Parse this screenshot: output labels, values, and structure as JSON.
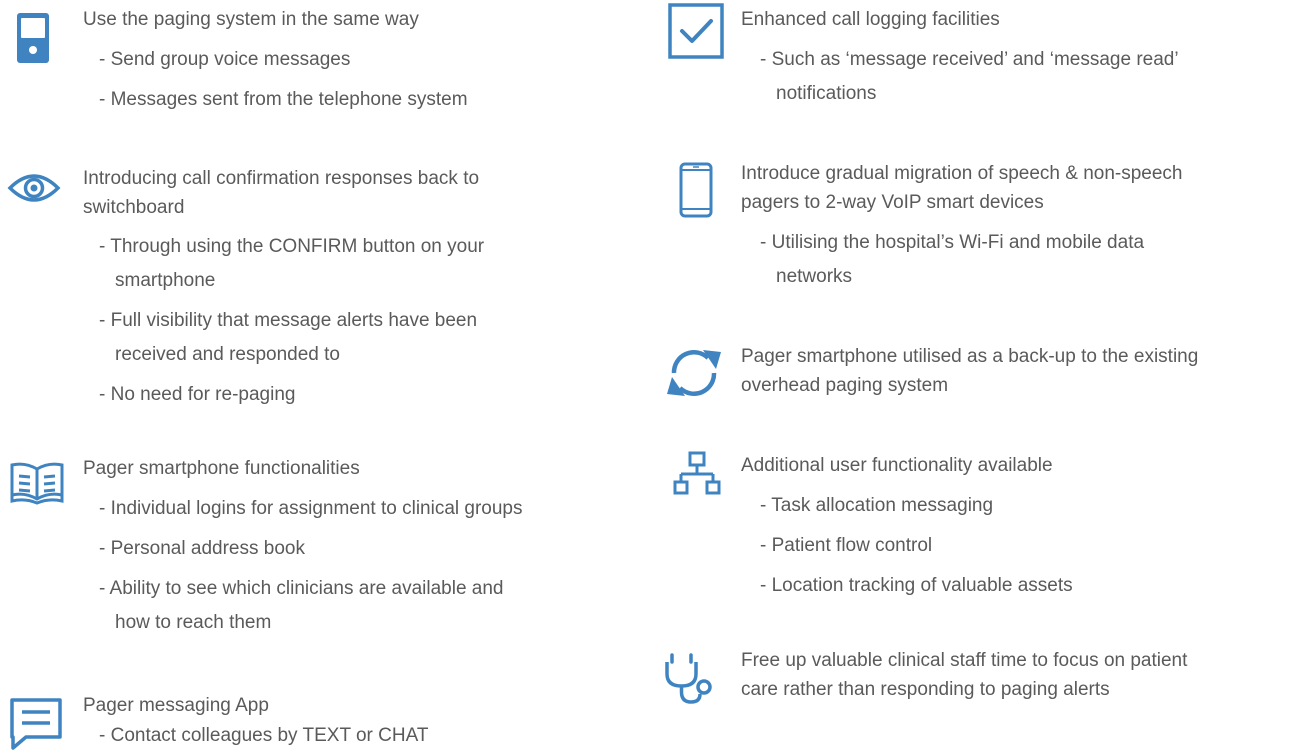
{
  "left": {
    "b1": {
      "icon": "pager-icon",
      "heading": "Use the paging system in the same way",
      "items": [
        "- Send group voice messages",
        "- Messages sent from the telephone system"
      ]
    },
    "b2": {
      "icon": "eye-icon",
      "heading_line1": "Introducing call confirmation responses back to",
      "heading_line2": "switchboard",
      "items": [
        {
          "line1": "- Through using the CONFIRM button on your",
          "line2": "smartphone"
        },
        {
          "line1": "- Full visibility that message alerts have been",
          "line2": "received and responded to"
        },
        {
          "line1": "- No need for re-paging",
          "line2": ""
        }
      ]
    },
    "b3": {
      "icon": "book-icon",
      "heading": "Pager smartphone functionalities",
      "items": [
        {
          "line1": "- Individual logins for assignment to clinical groups",
          "line2": ""
        },
        {
          "line1": "- Personal address book",
          "line2": ""
        },
        {
          "line1": "- Ability to see which clinicians are available and",
          "line2": "how to reach them"
        }
      ]
    },
    "b4": {
      "icon": "chat-icon",
      "heading": "Pager messaging App",
      "items": [
        "- Contact colleagues by TEXT or CHAT"
      ]
    }
  },
  "right": {
    "b1": {
      "icon": "checkbox-icon",
      "heading": "Enhanced call logging facilities",
      "item_line1": "- Such as ‘message received’ and ‘message read’",
      "item_line2": "notifications"
    },
    "b2": {
      "icon": "smartphone-icon",
      "heading_line1": "Introduce gradual migration of speech & non-speech",
      "heading_line2": "pagers to 2-way VoIP smart devices",
      "item_line1": "- Utilising the hospital’s Wi-Fi and mobile data",
      "item_line2": "networks"
    },
    "b3": {
      "icon": "sync-icon",
      "heading_line1": "Pager smartphone utilised as a back-up to the existing",
      "heading_line2": "overhead paging system"
    },
    "b4": {
      "icon": "network-icon",
      "heading": "Additional user functionality available",
      "items": [
        "- Task allocation messaging",
        "- Patient flow control",
        "- Location tracking of valuable assets"
      ]
    },
    "b5": {
      "icon": "stethoscope-icon",
      "heading_line1": "Free up valuable clinical staff time to focus on patient",
      "heading_line2": "care rather than responding to paging alerts"
    }
  },
  "colors": {
    "accent": "#3f84c1",
    "text": "#5a5a5a"
  }
}
